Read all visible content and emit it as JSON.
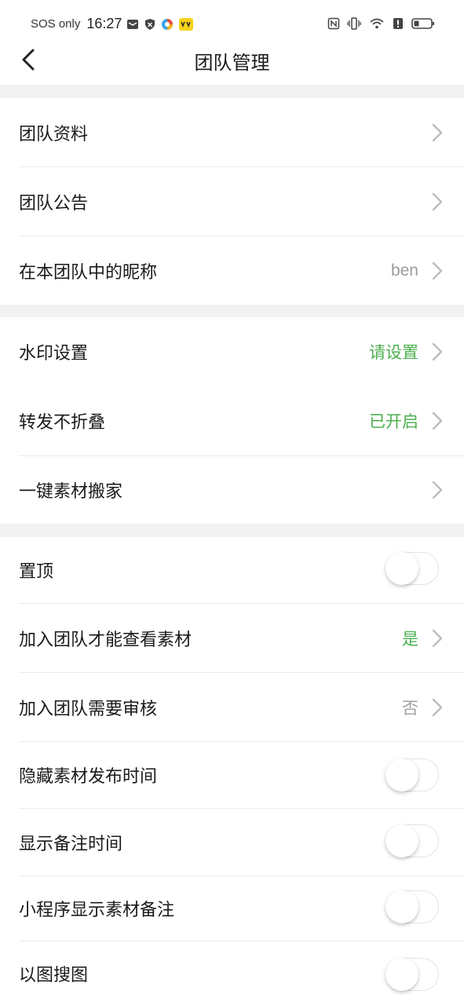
{
  "status_bar": {
    "carrier": "SOS only",
    "time": "16:27"
  },
  "header": {
    "title": "团队管理"
  },
  "sections": [
    [
      {
        "label": "团队资料",
        "value": "",
        "kind": "chevron"
      },
      {
        "label": "团队公告",
        "value": "",
        "kind": "chevron"
      },
      {
        "label": "在本团队中的昵称",
        "value": "ben",
        "kind": "chevron"
      }
    ],
    [
      {
        "label": "水印设置",
        "value": "请设置",
        "kind": "chevron"
      },
      {
        "label": "转发不折叠",
        "value": "已开启",
        "kind": "chevron"
      },
      {
        "label": "一键素材搬家",
        "value": "",
        "kind": "chevron"
      }
    ],
    [
      {
        "label": "置顶",
        "kind": "toggle",
        "on": false
      },
      {
        "label": "加入团队才能查看素材",
        "value": "是",
        "kind": "chevron"
      },
      {
        "label": "加入团队需要审核",
        "value": "否",
        "kind": "chevron"
      },
      {
        "label": "隐藏素材发布时间",
        "kind": "toggle",
        "on": false
      },
      {
        "label": "显示备注时间",
        "kind": "toggle",
        "on": false
      },
      {
        "label": "小程序显示素材备注",
        "kind": "toggle",
        "on": false
      },
      {
        "label": "以图搜图",
        "kind": "toggle",
        "on": false
      }
    ]
  ],
  "colors": {
    "accent_green": "#4caf50",
    "secondary_gray": "#9b9b9b",
    "section_gap": "#f2f2f2"
  }
}
